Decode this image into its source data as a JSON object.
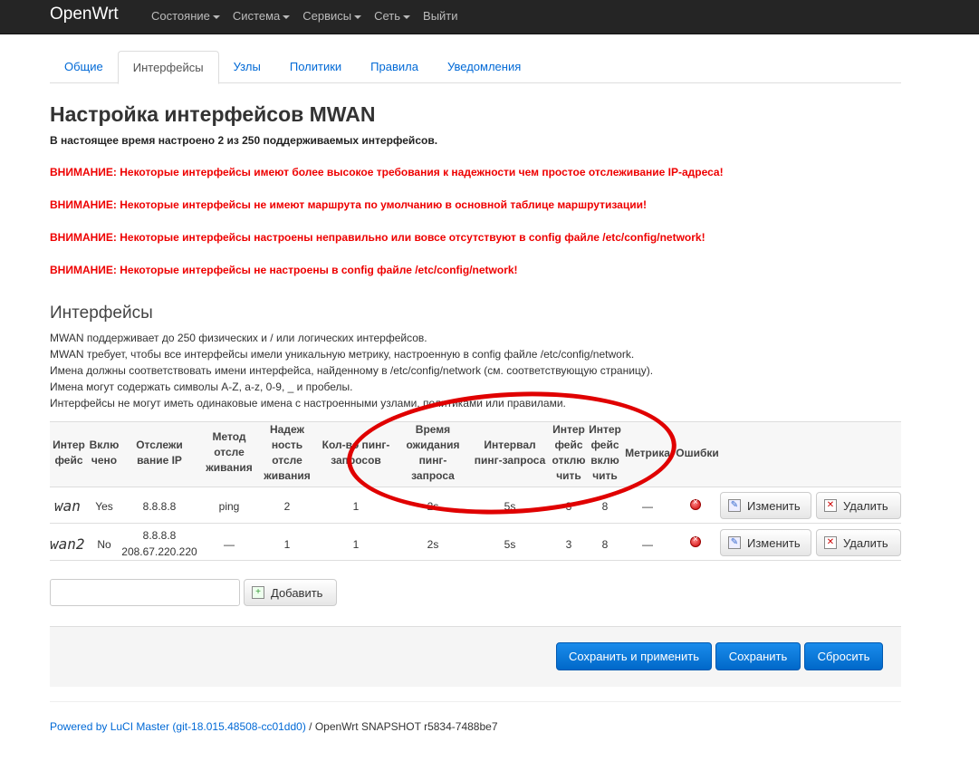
{
  "navbar": {
    "brand": "OpenWrt",
    "items": [
      {
        "label": "Состояние",
        "dropdown": true
      },
      {
        "label": "Система",
        "dropdown": true
      },
      {
        "label": "Сервисы",
        "dropdown": true
      },
      {
        "label": "Сеть",
        "dropdown": true
      },
      {
        "label": "Выйти",
        "dropdown": false
      }
    ]
  },
  "tabs": [
    {
      "label": "Общие",
      "active": false
    },
    {
      "label": "Интерфейсы",
      "active": true
    },
    {
      "label": "Узлы",
      "active": false
    },
    {
      "label": "Политики",
      "active": false
    },
    {
      "label": "Правила",
      "active": false
    },
    {
      "label": "Уведомления",
      "active": false
    }
  ],
  "page": {
    "title": "Настройка интерфейсов MWAN",
    "subtitle": "В настоящее время настроено 2 из 250 поддерживаемых интерфейсов.",
    "warnings": [
      "ВНИМАНИЕ: Некоторые интерфейсы имеют более высокое требования к надежности чем простое отслеживание IP-адреса!",
      "ВНИМАНИЕ: Некоторые интерфейсы не имеют маршрута по умолчанию в основной таблице маршрутизации!",
      "ВНИМАНИЕ: Некоторые интерфейсы настроены неправильно или вовсе отсутствуют в config файле /etc/config/network!",
      "ВНИМАНИЕ: Некоторые интерфейсы не настроены в config файле /etc/config/network!"
    ]
  },
  "section": {
    "title": "Интерфейсы",
    "description": [
      "MWAN поддерживает до 250 физических и / или логических интерфейсов.",
      "MWAN требует, чтобы все интерфейсы имели уникальную метрику, настроенную в config файле /etc/config/network.",
      "Имена должны соответствовать имени интерфейса, найденному в /etc/config/network (см. соответствующую страницу).",
      "Имена могут содержать символы A-Z, a-z, 0-9, _ и пробелы.",
      "Интерфейсы не могут иметь одинаковые имена с настроенными узлами, политиками или правилами."
    ]
  },
  "table": {
    "headers": {
      "iface": [
        "Интер",
        "фейс"
      ],
      "enabled": [
        "Вклю",
        "чено"
      ],
      "track_ip": [
        "Отслежи",
        "вание IP"
      ],
      "track_method": [
        "Метод",
        "отсле",
        "живания"
      ],
      "reliability": [
        "Надеж",
        "ность",
        "отсле",
        "живания"
      ],
      "count": [
        "Кол-во пинг-",
        "запросов"
      ],
      "timeout": [
        "Время",
        "ожидания",
        "пинг-",
        "запроса"
      ],
      "interval": [
        "Интервал",
        "пинг-запроса"
      ],
      "down": [
        "Интер",
        "фейс",
        "отклю",
        "чить"
      ],
      "up": [
        "Интер",
        "фейс",
        "вклю",
        "чить"
      ],
      "metric": [
        "Метрика"
      ],
      "errors": [
        "Ошибки"
      ]
    },
    "rows": [
      {
        "name": "wan",
        "enabled": "Yes",
        "track_ip": [
          "8.8.8.8"
        ],
        "track_method": "ping",
        "reliability": "2",
        "count": "1",
        "timeout": "2s",
        "interval": "5s",
        "down": "3",
        "up": "8",
        "metric": "—"
      },
      {
        "name": "wan2",
        "enabled": "No",
        "track_ip": [
          "8.8.8.8",
          "208.67.220.220"
        ],
        "track_method": "—",
        "reliability": "1",
        "count": "1",
        "timeout": "2s",
        "interval": "5s",
        "down": "3",
        "up": "8",
        "metric": "—"
      }
    ],
    "edit_label": "Изменить",
    "delete_label": "Удалить"
  },
  "add": {
    "label": "Добавить",
    "value": ""
  },
  "actions": {
    "save_apply": "Сохранить и применить",
    "save": "Сохранить",
    "reset": "Сбросить"
  },
  "footer": {
    "link": "Powered by LuCI Master (git-18.015.48508-cc01dd0)",
    "text": " / OpenWrt SNAPSHOT r5834-7488be7"
  },
  "colors": {
    "accent": "#0069d6",
    "warning": "#e00000",
    "navbar": "#252525",
    "primary_button": "#0a7de0"
  }
}
